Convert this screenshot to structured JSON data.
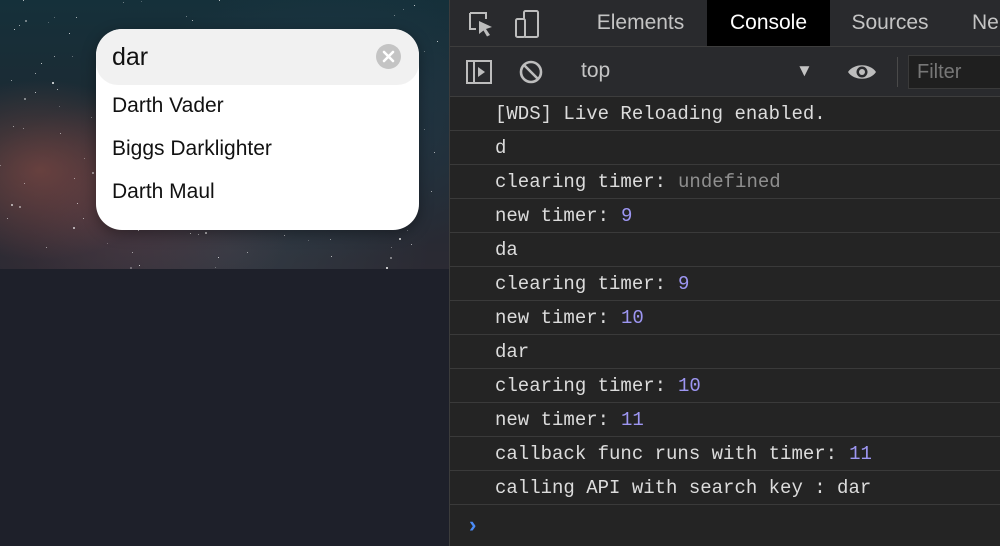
{
  "search": {
    "value": "dar",
    "results": [
      "Darth Vader",
      "Biggs Darklighter",
      "Darth Maul"
    ]
  },
  "devtools": {
    "tabs": [
      {
        "label": "Elements",
        "active": false
      },
      {
        "label": "Console",
        "active": true
      },
      {
        "label": "Sources",
        "active": false
      },
      {
        "label": "Ne",
        "active": false
      }
    ],
    "toolbar": {
      "context": "top",
      "filter_placeholder": "Filter"
    },
    "console": [
      {
        "text": "[WDS] Live Reloading enabled.",
        "value": "",
        "value_type": ""
      },
      {
        "text": "d",
        "value": "",
        "value_type": ""
      },
      {
        "text": "clearing timer:",
        "value": "undefined",
        "value_type": "undefined"
      },
      {
        "text": "new timer:",
        "value": "9",
        "value_type": "number"
      },
      {
        "text": "da",
        "value": "",
        "value_type": ""
      },
      {
        "text": "clearing timer:",
        "value": "9",
        "value_type": "number"
      },
      {
        "text": "new timer:",
        "value": "10",
        "value_type": "number"
      },
      {
        "text": "dar",
        "value": "",
        "value_type": ""
      },
      {
        "text": "clearing timer:",
        "value": "10",
        "value_type": "number"
      },
      {
        "text": "new timer:",
        "value": "11",
        "value_type": "number"
      },
      {
        "text": "callback func runs with timer:",
        "value": "11",
        "value_type": "number"
      },
      {
        "text": "calling API with search key : dar",
        "value": "",
        "value_type": ""
      }
    ],
    "prompt": "›"
  },
  "colors": {
    "console_number": "#9d96f2",
    "console_undefined": "#8f8f8f",
    "prompt_chevron": "#4b8cf7",
    "active_tab_bg": "#000000"
  },
  "icons": {
    "clear": "clear-icon",
    "inspect": "inspect-element-icon",
    "device": "device-toggle-icon",
    "sidebar": "sidebar-toggle-icon",
    "clear_console": "clear-console-icon",
    "eye": "eye-icon"
  }
}
